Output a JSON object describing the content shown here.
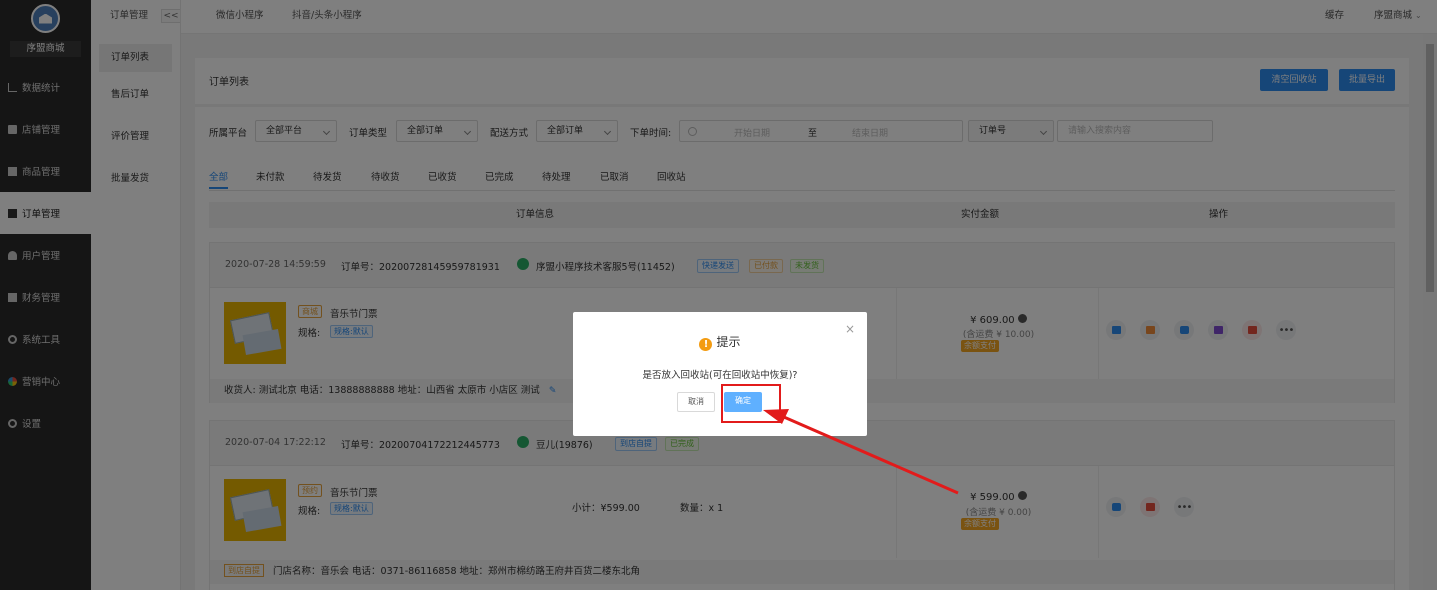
{
  "sidebar": {
    "brand": "序盟商城",
    "items": [
      {
        "label": "数据统计",
        "icon": "chart-icon"
      },
      {
        "label": "店铺管理",
        "icon": "store-icon"
      },
      {
        "label": "商品管理",
        "icon": "goods-icon"
      },
      {
        "label": "订单管理",
        "icon": "order-icon"
      },
      {
        "label": "用户管理",
        "icon": "user-icon"
      },
      {
        "label": "财务管理",
        "icon": "finance-icon"
      },
      {
        "label": "系统工具",
        "icon": "wrench-icon"
      },
      {
        "label": "营销中心",
        "icon": "marketing-icon"
      },
      {
        "label": "设置",
        "icon": "settings-icon"
      }
    ],
    "active_index": 3
  },
  "subnav": {
    "title": "订单管理",
    "collapse": "<<",
    "items": [
      "订单列表",
      "售后订单",
      "评价管理",
      "批量发货"
    ]
  },
  "topbar": {
    "tabs": [
      "微信小程序",
      "抖音/头条小程序"
    ],
    "clear_cache": "缓存",
    "store_name": "序盟商城"
  },
  "page": {
    "title": "订单列表",
    "clear_recycle": "清空回收站",
    "batch_export": "批量导出"
  },
  "filters": {
    "platform_label": "所属平台",
    "platform_value": "全部平台",
    "type_label": "订单类型",
    "type_value": "全部订单",
    "delivery_label": "配送方式",
    "delivery_value": "全部订单",
    "time_label": "下单时间:",
    "start_placeholder": "开始日期",
    "range_sep": "至",
    "end_placeholder": "结束日期",
    "search_field": "订单号",
    "search_placeholder": "请输入搜索内容"
  },
  "tabs": [
    "全部",
    "未付款",
    "待发货",
    "待收货",
    "已收货",
    "已完成",
    "待处理",
    "已取消",
    "回收站"
  ],
  "table_header": {
    "info": "订单信息",
    "amount": "实付金额",
    "ops": "操作"
  },
  "orders": [
    {
      "time": "2020-07-28 14:59:59",
      "order_no": "订单号：20200728145959781931",
      "customer": "序盟小程序技术客服5号(11452)",
      "badges": [
        "快递发送",
        "已付款",
        "未发货"
      ],
      "goods_tag": "商城",
      "goods_name": "音乐节门票",
      "spec_label": "规格:",
      "spec_value": "规格:默认",
      "price": "¥ 609.00",
      "shipping": "(含运费 ¥ 10.00)",
      "pay_tag": "余额支付",
      "footer": "收货人: 测试北京 电话：13888888888 地址：山西省 太原市 小店区 测试"
    },
    {
      "time": "2020-07-04 17:22:12",
      "order_no": "订单号：20200704172212445773",
      "customer": "豆儿(19876)",
      "badges": [
        "到店自提",
        "已完成"
      ],
      "goods_tag": "预约",
      "goods_name": "音乐节门票",
      "spec_label": "规格:",
      "spec_value": "规格:默认",
      "subtotal": "小计：¥599.00",
      "quantity": "数量：x 1",
      "price": "¥ 599.00",
      "shipping": "(含运费 ¥ 0.00)",
      "pay_tag": "余额支付",
      "footer_tag": "到店自提",
      "footer": "门店名称：音乐会 电话：0371-86116858 地址：郑州市棉纺路王府井百货二楼东北角"
    }
  ],
  "modal": {
    "title": "提示",
    "message": "是否放入回收站(可在回收站中恢复)?",
    "cancel": "取消",
    "confirm": "确定",
    "close": "×"
  },
  "colors": {
    "primary": "#2d8cf0",
    "sidebar": "#2b2b2b",
    "annotation": "#e21b1b",
    "warning": "#f39c12"
  }
}
